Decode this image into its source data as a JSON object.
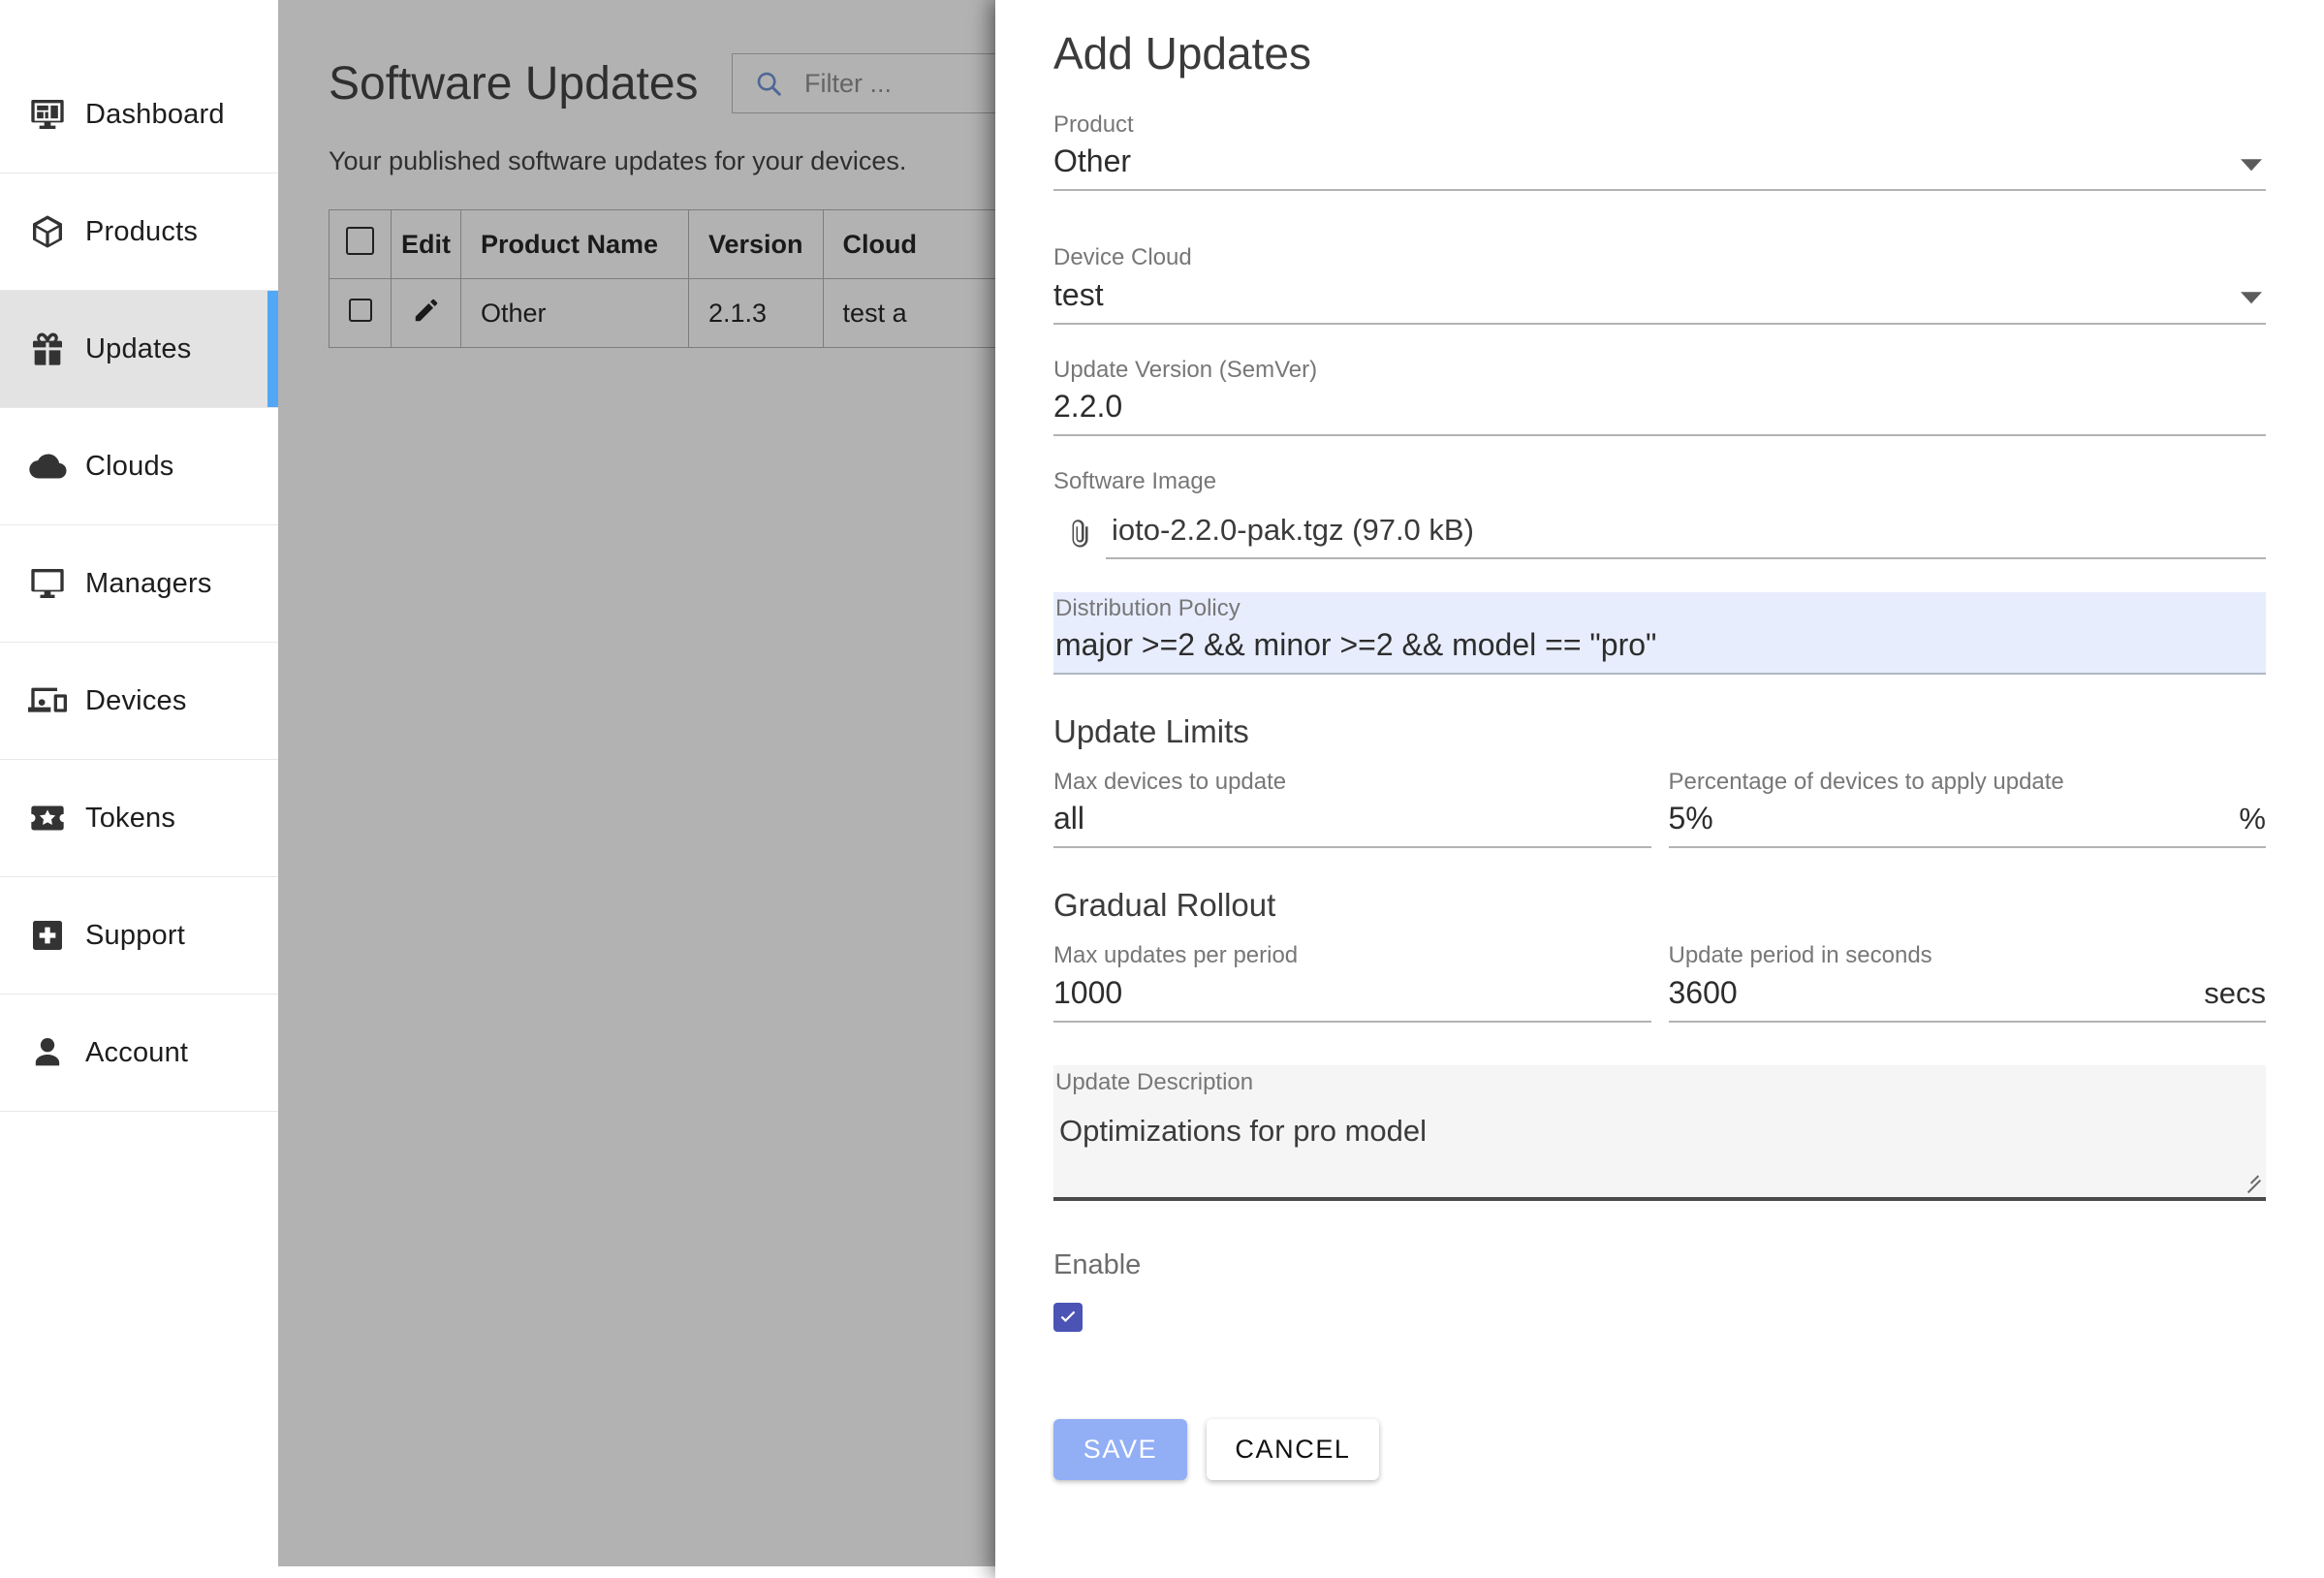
{
  "sidebar": {
    "items": [
      {
        "label": "Dashboard",
        "icon": "dashboard-icon",
        "active": false
      },
      {
        "label": "Products",
        "icon": "cube-icon",
        "active": false
      },
      {
        "label": "Updates",
        "icon": "gift-icon",
        "active": true
      },
      {
        "label": "Clouds",
        "icon": "cloud-icon",
        "active": false
      },
      {
        "label": "Managers",
        "icon": "monitor-icon",
        "active": false
      },
      {
        "label": "Devices",
        "icon": "devices-icon",
        "active": false
      },
      {
        "label": "Tokens",
        "icon": "ticket-star-icon",
        "active": false
      },
      {
        "label": "Support",
        "icon": "medical-plus-icon",
        "active": false
      },
      {
        "label": "Account",
        "icon": "person-icon",
        "active": false
      }
    ],
    "active_indicator_color": "#52a8f7"
  },
  "main": {
    "title": "Software Updates",
    "subtitle": "Your published software updates for your devices.",
    "filter": {
      "placeholder": "Filter ...",
      "value": "",
      "icon": "search-icon",
      "icon_color": "#6b8fd4"
    },
    "table": {
      "columns": [
        "",
        "Edit",
        "Product Name",
        "Version",
        "Cloud",
        ""
      ],
      "rows": [
        {
          "checkbox": false,
          "edit_icon": "pencil-icon",
          "product_name": "Other",
          "version": "2.1.3",
          "cloud": "test a"
        }
      ]
    }
  },
  "modal": {
    "title": "Add Updates",
    "product": {
      "label": "Product",
      "value": "Other",
      "icon": "chevron-down-icon"
    },
    "device_cloud": {
      "label": "Device Cloud",
      "value": "test",
      "icon": "chevron-down-icon"
    },
    "update_version": {
      "label": "Update Version (SemVer)",
      "value": "2.2.0"
    },
    "software_image": {
      "label": "Software Image",
      "file_name": "ioto-2.2.0-pak.tgz (97.0 kB)",
      "icon": "paperclip-icon"
    },
    "distribution_policy": {
      "label": "Distribution Policy",
      "value": "major >=2 && minor >=2 && model == \"pro\"",
      "highlight_color": "#e8edfe"
    },
    "update_limits": {
      "heading": "Update Limits",
      "max_devices": {
        "label": "Max devices to update",
        "value": "all"
      },
      "percentage": {
        "label": "Percentage of devices to apply update",
        "value": "5%",
        "suffix": "%"
      }
    },
    "gradual_rollout": {
      "heading": "Gradual Rollout",
      "max_updates": {
        "label": "Max updates per period",
        "value": "1000"
      },
      "update_period": {
        "label": "Update period in seconds",
        "value": "3600",
        "suffix": "secs"
      }
    },
    "description": {
      "label": "Update Description",
      "value": "Optimizations for pro model"
    },
    "enable": {
      "label": "Enable",
      "checked": true,
      "color": "#4b53b5"
    },
    "buttons": {
      "save": "SAVE",
      "cancel": "CANCEL",
      "save_color": "#92aef5"
    }
  }
}
